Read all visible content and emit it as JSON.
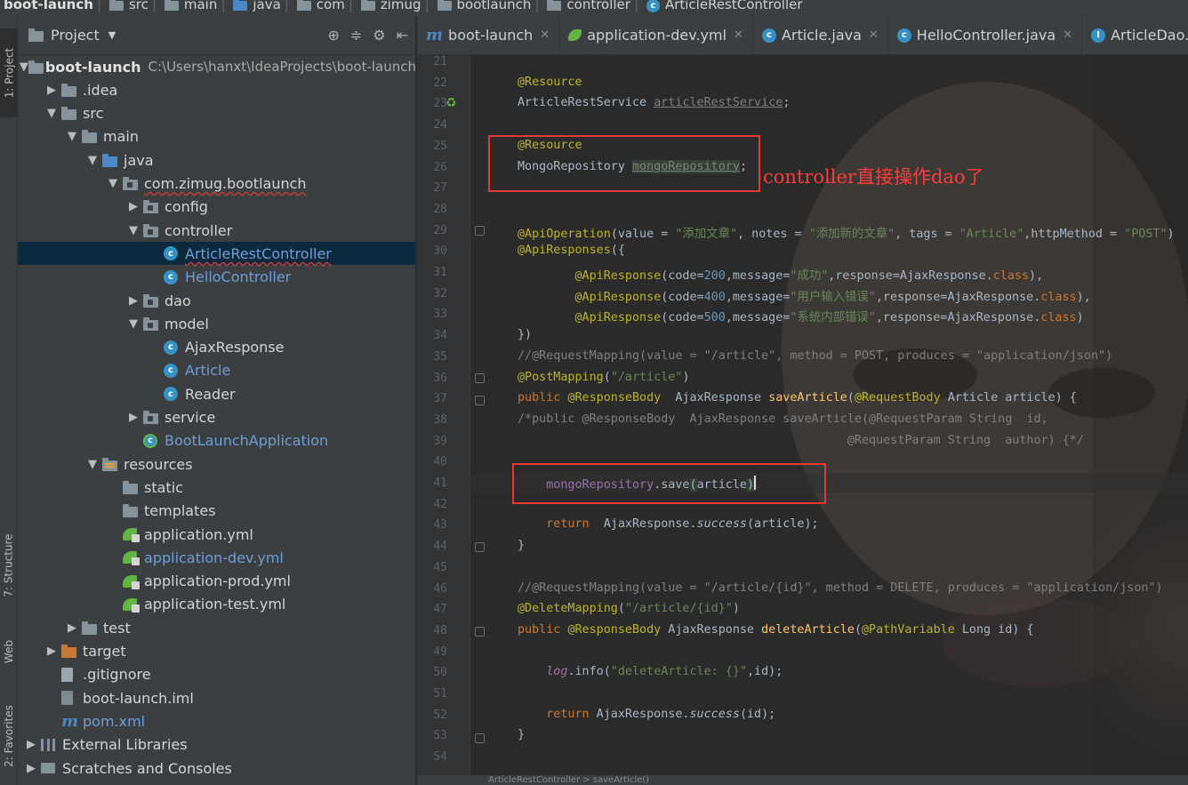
{
  "breadcrumb": [
    {
      "label": "boot-launch",
      "icon": "folder-icon"
    },
    {
      "label": "src",
      "icon": "folder-icon"
    },
    {
      "label": "main",
      "icon": "folder-icon"
    },
    {
      "label": "java",
      "icon": "source-folder-icon"
    },
    {
      "label": "com",
      "icon": "package-icon"
    },
    {
      "label": "zimug",
      "icon": "package-icon"
    },
    {
      "label": "bootlaunch",
      "icon": "package-icon"
    },
    {
      "label": "controller",
      "icon": "package-icon"
    },
    {
      "label": "ArticleRestController",
      "icon": "class-icon"
    }
  ],
  "tool_stripe": {
    "project": "1: Project",
    "structure": "7: Structure",
    "web": "Web",
    "favorites": "2: Favorites"
  },
  "project_panel": {
    "title": "Project",
    "tree": [
      {
        "label": "boot-launch",
        "path": "C:\\Users\\hanxt\\IdeaProjects\\boot-launch",
        "depth": 0,
        "arrow": "down",
        "icon": "module-folder-icon",
        "bold": true
      },
      {
        "label": ".idea",
        "depth": 1,
        "arrow": "right",
        "icon": "folder-icon"
      },
      {
        "label": "src",
        "depth": 1,
        "arrow": "down",
        "icon": "folder-icon"
      },
      {
        "label": "main",
        "depth": 2,
        "arrow": "down",
        "icon": "folder-icon"
      },
      {
        "label": "java",
        "depth": 3,
        "arrow": "down",
        "icon": "source-folder-icon"
      },
      {
        "label": "com.zimug.bootlaunch",
        "depth": 4,
        "arrow": "down",
        "icon": "package-icon",
        "underline": true
      },
      {
        "label": "config",
        "depth": 5,
        "arrow": "right",
        "icon": "package-icon"
      },
      {
        "label": "controller",
        "depth": 5,
        "arrow": "down",
        "icon": "package-icon"
      },
      {
        "label": "ArticleRestController",
        "depth": 6,
        "icon": "class-icon",
        "blue": true,
        "underline": true,
        "selected": true
      },
      {
        "label": "HelloController",
        "depth": 6,
        "icon": "class-icon",
        "blue": true
      },
      {
        "label": "dao",
        "depth": 5,
        "arrow": "right",
        "icon": "package-icon"
      },
      {
        "label": "model",
        "depth": 5,
        "arrow": "down",
        "icon": "package-icon"
      },
      {
        "label": "AjaxResponse",
        "depth": 6,
        "icon": "class-icon"
      },
      {
        "label": "Article",
        "depth": 6,
        "icon": "class-icon",
        "blue": true
      },
      {
        "label": "Reader",
        "depth": 6,
        "icon": "class-icon"
      },
      {
        "label": "service",
        "depth": 5,
        "arrow": "right",
        "icon": "package-icon"
      },
      {
        "label": "BootLaunchApplication",
        "depth": 5,
        "icon": "spring-class-icon",
        "blue": true
      },
      {
        "label": "resources",
        "depth": 3,
        "arrow": "down",
        "icon": "resources-folder-icon"
      },
      {
        "label": "static",
        "depth": 4,
        "icon": "folder-icon"
      },
      {
        "label": "templates",
        "depth": 4,
        "icon": "folder-icon"
      },
      {
        "label": "application.yml",
        "depth": 4,
        "icon": "spring-yml-icon"
      },
      {
        "label": "application-dev.yml",
        "depth": 4,
        "icon": "spring-yml-icon",
        "blue": true
      },
      {
        "label": "application-prod.yml",
        "depth": 4,
        "icon": "spring-yml-icon"
      },
      {
        "label": "application-test.yml",
        "depth": 4,
        "icon": "spring-yml-icon"
      },
      {
        "label": "test",
        "depth": 2,
        "arrow": "right",
        "icon": "folder-icon"
      },
      {
        "label": "target",
        "depth": 1,
        "arrow": "right",
        "icon": "excluded-folder-icon"
      },
      {
        "label": ".gitignore",
        "depth": 1,
        "icon": "file-icon"
      },
      {
        "label": "boot-launch.iml",
        "depth": 1,
        "icon": "iml-file-icon"
      },
      {
        "label": "pom.xml",
        "depth": 1,
        "icon": "maven-icon",
        "blue": true
      },
      {
        "label": "External Libraries",
        "depth": 0,
        "arrow": "right",
        "icon": "library-icon"
      },
      {
        "label": "Scratches and Consoles",
        "depth": 0,
        "arrow": "right",
        "icon": "scratches-icon"
      }
    ]
  },
  "tabs": [
    {
      "label": "boot-launch",
      "icon": "maven-icon"
    },
    {
      "label": "application-dev.yml",
      "icon": "spring-yml-icon"
    },
    {
      "label": "Article.java",
      "icon": "class-icon"
    },
    {
      "label": "HelloController.java",
      "icon": "class-icon"
    },
    {
      "label": "ArticleDao.java",
      "icon": "interface-icon"
    }
  ],
  "editor": {
    "lines": [
      {
        "n": "21",
        "html": ""
      },
      {
        "n": "22",
        "html": "<span class=\"ann\">@Resource</span>"
      },
      {
        "n": "23",
        "html": "ArticleRestService <span class=\"unused\">articleRestService</span>;"
      },
      {
        "n": "24",
        "html": ""
      },
      {
        "n": "25",
        "html": "<span class=\"ann\">@Resource</span>"
      },
      {
        "n": "26",
        "html": "MongoRepository <span class=\"unused hl\">mongoRepository</span>;"
      },
      {
        "n": "27",
        "html": ""
      },
      {
        "n": "28",
        "html": ""
      },
      {
        "n": "29",
        "html": "<span class=\"ann\">@ApiOperation</span>(value = <span class=\"str\">\"添加文章\"</span>, notes = <span class=\"str\">\"添加新的文章\"</span>, tags = <span class=\"str\">\"Article\"</span>,httpMethod = <span class=\"str\">\"POST\"</span>)"
      },
      {
        "n": "30",
        "html": "<span class=\"ann\">@ApiResponses</span>({"
      },
      {
        "n": "31",
        "html": "        <span class=\"ann\">@ApiResponse</span>(code=<span class=\"num\">200</span>,message=<span class=\"str\">\"成功\"</span>,response=AjaxResponse.<span class=\"kw\">class</span>),"
      },
      {
        "n": "32",
        "html": "        <span class=\"ann\">@ApiResponse</span>(code=<span class=\"num\">400</span>,message=<span class=\"str\">\"用户输入错误\"</span>,response=AjaxResponse.<span class=\"kw\">class</span>),"
      },
      {
        "n": "33",
        "html": "        <span class=\"ann\">@ApiResponse</span>(code=<span class=\"num\">500</span>,message=<span class=\"str\">\"系统内部错误\"</span>,response=AjaxResponse.<span class=\"kw\">class</span>)"
      },
      {
        "n": "34",
        "html": "})"
      },
      {
        "n": "35",
        "html": "<span class=\"cmt\">//@RequestMapping(value = \"/article\", method = POST, produces = \"application/json\")</span>"
      },
      {
        "n": "36",
        "html": "<span class=\"ann\">@PostMapping</span>(<span class=\"str\">\"/article\"</span>)"
      },
      {
        "n": "37",
        "html": "<span class=\"kw\">public</span> <span class=\"ann\">@ResponseBody</span>  AjaxResponse <span class=\"fn\">saveArticle</span>(<span class=\"ann\">@RequestBody</span> Article article) {"
      },
      {
        "n": "38",
        "html": "<span class=\"cmt\">/*public @ResponseBody  AjaxResponse saveArticle(@RequestParam String  id,</span>"
      },
      {
        "n": "39",
        "html": "<span class=\"cmt\">                                              @RequestParam String  author) {*/</span>"
      },
      {
        "n": "40",
        "html": ""
      },
      {
        "n": "41",
        "html": "    <span class=\"fld2\">mongoRepository</span>.save<span class=\"hl\">(</span>article<span class=\"hl\">)</span><span class=\"cursor\"></span>"
      },
      {
        "n": "42",
        "html": ""
      },
      {
        "n": "43",
        "html": "    <span class=\"kw\">return</span>  AjaxResponse.<span class=\"it\">success</span>(article);"
      },
      {
        "n": "44",
        "html": "}"
      },
      {
        "n": "45",
        "html": ""
      },
      {
        "n": "46",
        "html": "<span class=\"cmt\">//@RequestMapping(value = \"/article/{id}\", method = DELETE, produces = \"application/json\")</span>"
      },
      {
        "n": "47",
        "html": "<span class=\"ann\">@DeleteMapping</span>(<span class=\"str\">\"/article/{id}\"</span>)"
      },
      {
        "n": "48",
        "html": "<span class=\"kw\">public</span> <span class=\"ann\">@ResponseBody</span> AjaxResponse <span class=\"fn\">deleteArticle</span>(<span class=\"ann\">@PathVariable</span> Long id) {"
      },
      {
        "n": "49",
        "html": ""
      },
      {
        "n": "50",
        "html": "    <span class=\"fld2 it\">log</span>.info(<span class=\"str\">\"deleteArticle: {}\"</span>,id);"
      },
      {
        "n": "51",
        "html": ""
      },
      {
        "n": "52",
        "html": "    <span class=\"kw\">return</span> AjaxResponse.<span class=\"it\">success</span>(id);"
      },
      {
        "n": "53",
        "html": "}"
      },
      {
        "n": "54",
        "html": ""
      }
    ],
    "annotation": "controller直接操作dao了"
  },
  "bottom_bar": "ArticleRestController  >  saveArticle()",
  "colors": {
    "accent_red": "#e53935",
    "selection": "#0d293e"
  }
}
